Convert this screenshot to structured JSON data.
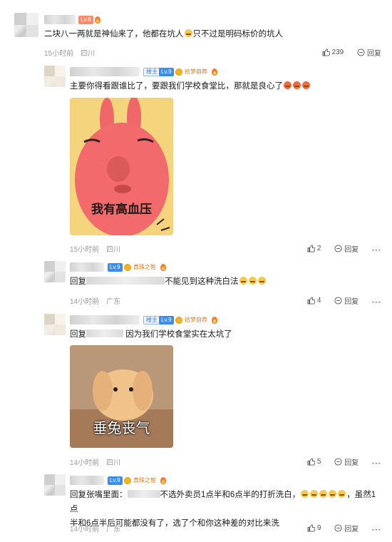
{
  "comments": [
    {
      "level": "Lv.8",
      "text": "二块八一两就是神仙来了，他都在坑人",
      "text2": "只不过是明码标价的坑人",
      "time": "15小时前",
      "location": "四川",
      "likes": "239",
      "reply_label": "回复"
    },
    {
      "host_badge": "楼主",
      "level": "Lv.9",
      "medal": "拾梦自荐",
      "text": "主要你得看跟谁比了，要跟我们学校食堂比，那就是良心了",
      "image_caption": "我有高血压",
      "time": "15小时前",
      "location": "四川",
      "likes": "2",
      "reply_label": "回复"
    },
    {
      "level": "Lv.9",
      "medal": "真珠之智",
      "text_prefix": "回复",
      "text": "不能见到这种洗白法",
      "time": "14小时前",
      "location": "广东",
      "likes": "4",
      "reply_label": "回复"
    },
    {
      "host_badge": "楼主",
      "level": "Lv.9",
      "medal": "拾梦自荐",
      "text_prefix": "回复",
      "text": "因为我们学校食堂实在太坑了",
      "image_caption": "垂兔丧气",
      "time": "14小时前",
      "location": "四川",
      "likes": "5",
      "reply_label": "回复"
    },
    {
      "level": "Lv.9",
      "medal": "真珠之智",
      "text_prefix": "回复",
      "text_prefix2": "张嘴里面：",
      "text": "不选外卖员1点半和6点半的打折洗白，",
      "text_mid": "，虽然1点",
      "text_line2": "半和6点半后可能都没有了，选了个和你这种差的对比来洗",
      "time": "14小时前",
      "location": "广东",
      "likes": "9",
      "reply_label": "回复"
    }
  ],
  "colors": {
    "lv8": "#ff8a6a",
    "lv9": "#3a8cf0",
    "medal": "#e07a1a",
    "meta": "#9a9a9a",
    "caption": "#1a1a1a"
  }
}
